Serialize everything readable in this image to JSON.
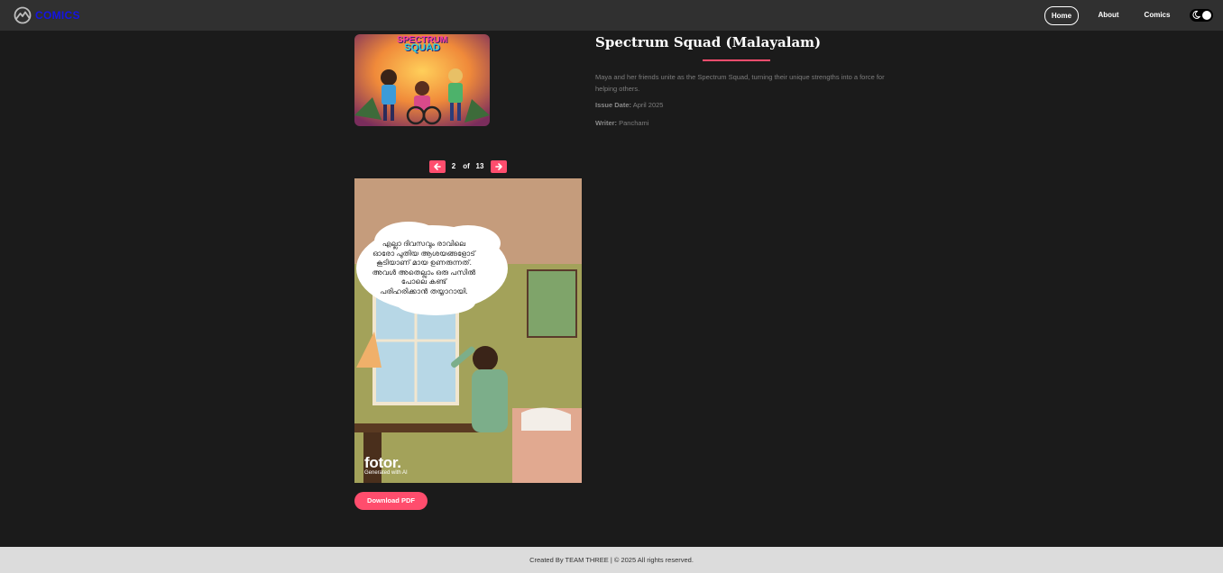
{
  "nav": {
    "brand": "COMICS",
    "links": [
      "Home",
      "About",
      "Comics"
    ]
  },
  "comic": {
    "title": "Spectrum Squad (Malayalam)",
    "description": "Maya and her friends unite as the Spectrum Squad, turning their unique strengths into a force for helping others.",
    "issue_label": "Issue Date:",
    "issue_date": "April 2025",
    "writer_label": "Writer:",
    "writer": "Panchami",
    "cover_title_lines": [
      "SPECTRUM",
      "SQUAD"
    ]
  },
  "pager": {
    "current": "2",
    "of": "of",
    "total": "13"
  },
  "page_image": {
    "speech_bubble": [
      "എല്ലാ ദിവസവും രാവിലെ",
      "ഓരോ പുതിയ ആശയങ്ങളോട്",
      "കൂടിയാണ് മായ ഉണരുന്നത്.",
      "അവൾ അതെല്ലാം ഒരു പസിൽ",
      "പോലെ കണ്ട്",
      "പരിഹരിക്കാൻ തയ്യാറായി."
    ],
    "watermark": "fotor.",
    "watermark_sub": "Generated with AI"
  },
  "actions": {
    "download": "Download PDF"
  },
  "footer": {
    "text": "Created By TEAM THREE | © 2025 All rights reserved."
  },
  "colors": {
    "accent": "#ff4d6d",
    "brand": "#1414e6",
    "navbar": "#303030",
    "background": "#1b1b1b",
    "footer": "#dcdcdc"
  }
}
